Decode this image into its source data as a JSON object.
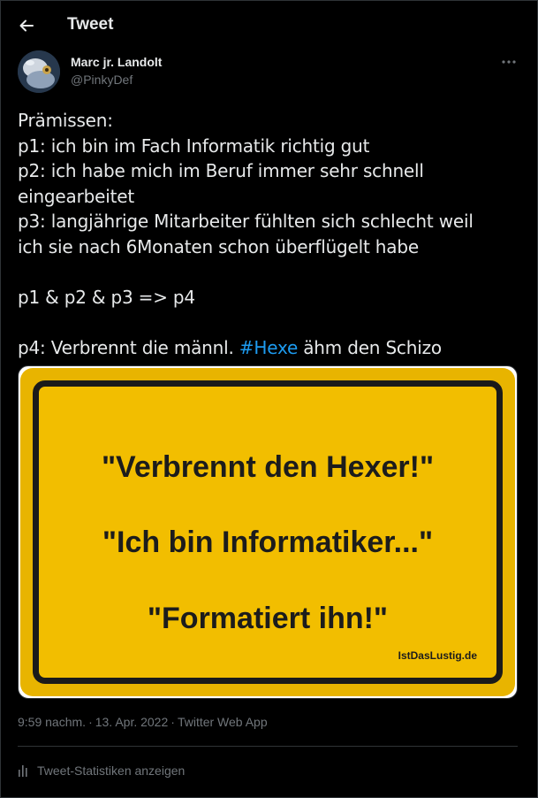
{
  "header": {
    "title": "Tweet",
    "back_icon": "arrow-left-icon"
  },
  "author": {
    "name": "Marc jr. Landolt",
    "handle": "@PinkyDef",
    "more_icon": "more-horizontal-icon"
  },
  "tweet": {
    "lines": [
      "Prämissen:",
      "p1: ich bin im Fach Informatik richtig gut",
      "p2: ich habe mich im Beruf immer sehr schnell",
      "eingearbeitet",
      "p3: langjährige Mitarbeiter fühlten sich schlecht weil",
      "ich sie nach 6Monaten schon überflügelt habe",
      "",
      "p1 & p2 & p3 => p4",
      ""
    ],
    "last_line_prefix": "p4: Verbrennt die männl. ",
    "hashtag": "#Hexe",
    "last_line_suffix": " ähm den Schizo",
    "link_color": "#1d9bf0"
  },
  "media": {
    "sign_lines": [
      "\"Verbrennt den Hexer!\"",
      "\"Ich bin Informatiker...\"",
      "\"Formatiert ihn!\""
    ],
    "watermark": "IstDasLustig.de",
    "sign_color": "#f2be00"
  },
  "meta": {
    "time": "9:59 nachm.",
    "separator": "·",
    "date": "13. Apr. 2022",
    "app": "Twitter Web App"
  },
  "stats": {
    "label": "Tweet-Statistiken anzeigen",
    "icon": "bar-chart-icon"
  }
}
